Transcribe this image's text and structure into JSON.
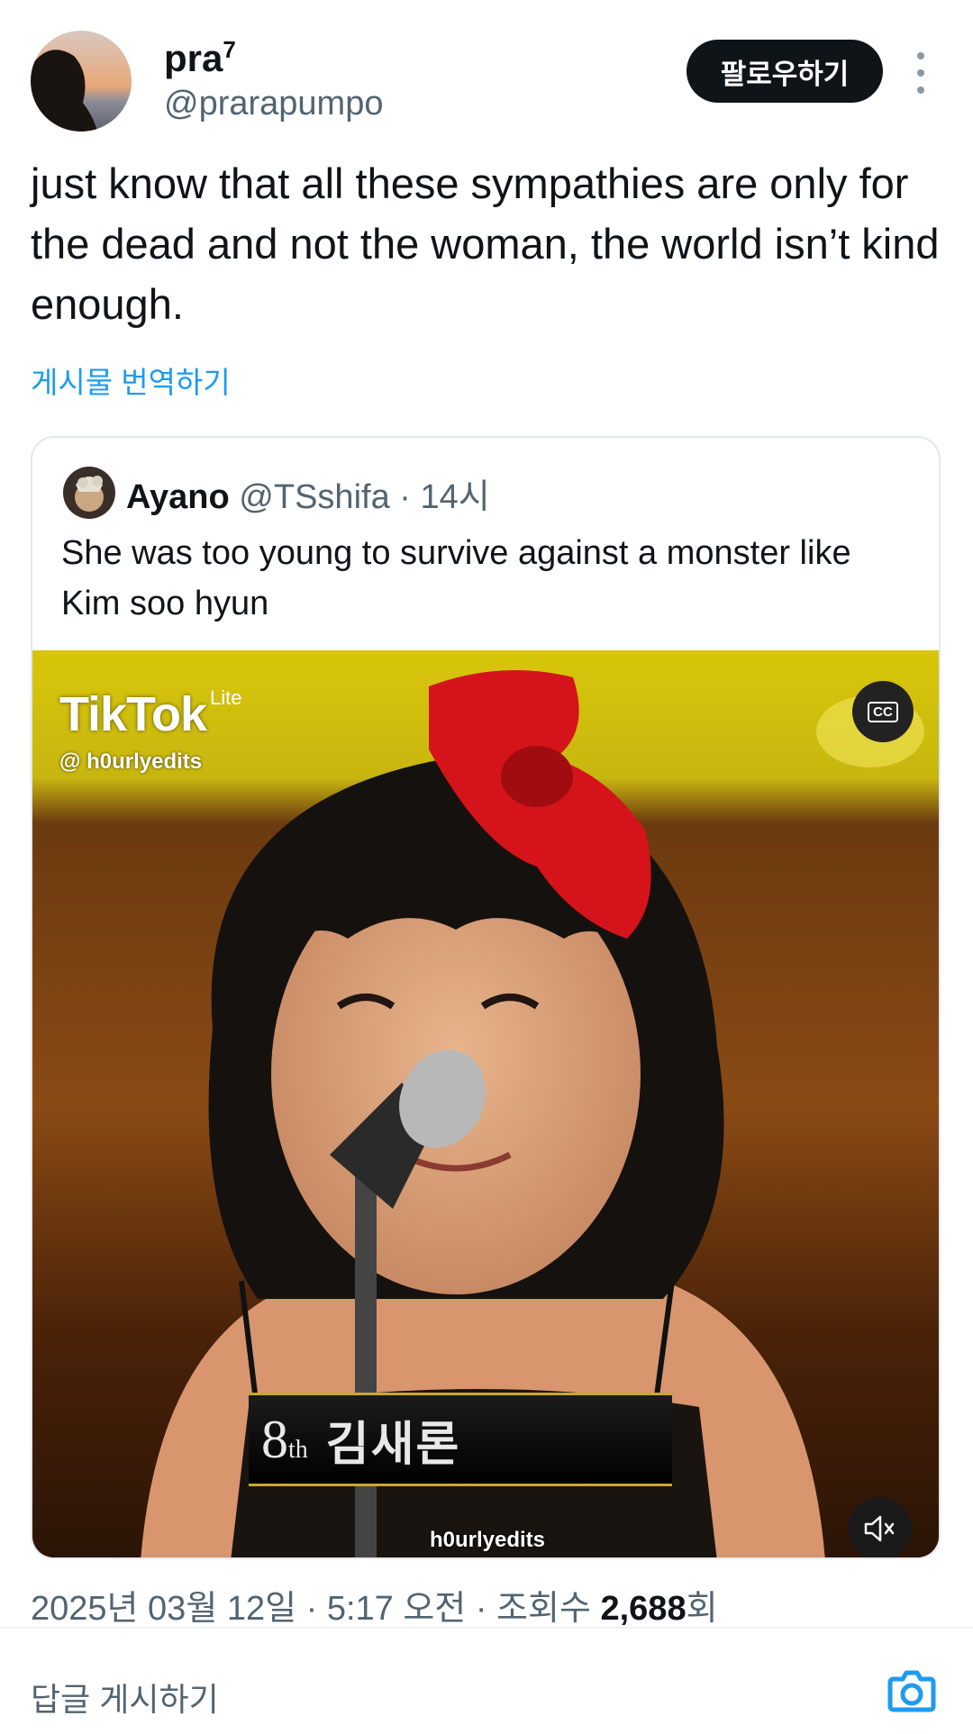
{
  "author": {
    "display_name": "pra",
    "display_name_sup": "7",
    "handle": "@prarapumpo",
    "follow_label": "팔로우하기"
  },
  "tweet": {
    "text": "just know that all these sympathies are only for the dead and not the woman, the world isn’t kind enough.",
    "translate_label": "게시물 번역하기"
  },
  "quote": {
    "name": "Ayano",
    "meta": "@TSshifa · 14시",
    "text": "She was too young to survive against a monster like Kim soo hyun",
    "video": {
      "tiktok_logo": "TikTok",
      "tiktok_lite": "Lite",
      "tiktok_handle": "@ h0urlyedits",
      "cc_label": "CC",
      "caption_ordinal": "8",
      "caption_ordinal_suffix": "th",
      "caption_name": "김새론",
      "watermark": "h0urlyedits"
    }
  },
  "meta": {
    "timestamp": "2025년 03월 12일 · 5:17 오전 · 조회수 ",
    "views": "2,688",
    "views_suffix": "회"
  },
  "reply": {
    "placeholder": "답글 게시하기"
  },
  "colors": {
    "text": "#0f1419",
    "secondary": "#536471",
    "link": "#1d9bf0",
    "follow_bg": "#0f1419"
  }
}
